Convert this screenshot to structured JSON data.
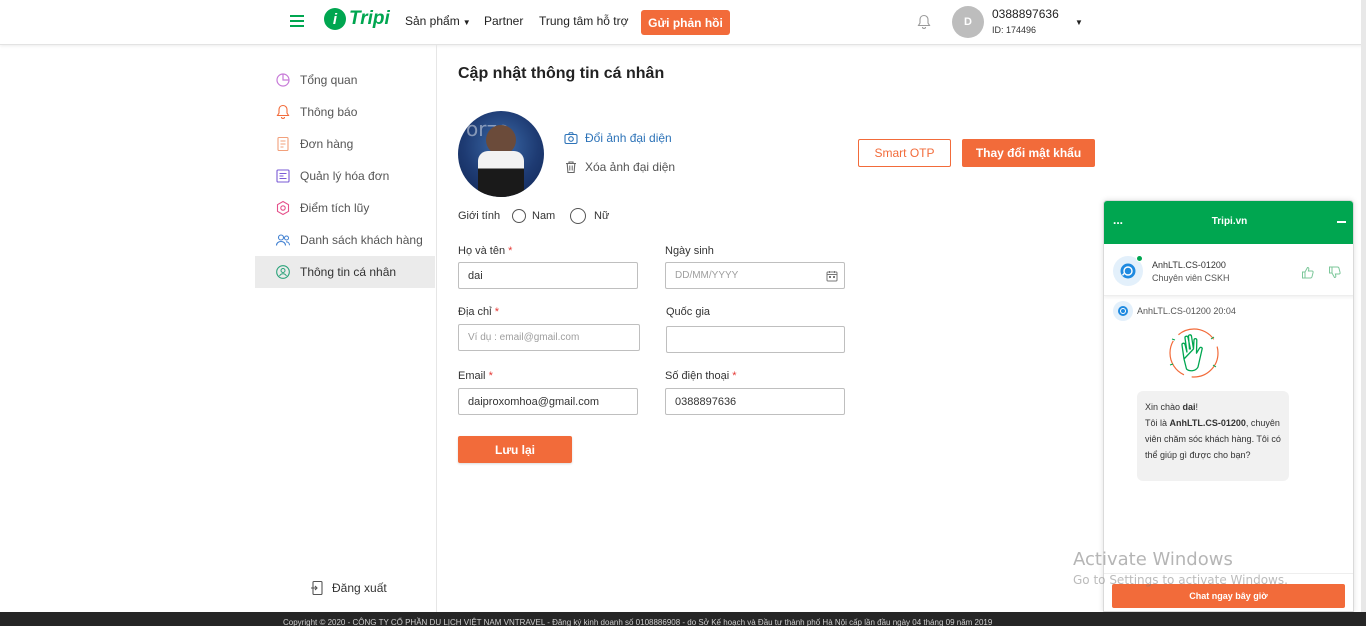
{
  "header": {
    "logo_mark": "i",
    "logo_text": "Tripi",
    "nav_products": "Sản phẩm",
    "nav_partner": "Partner",
    "nav_support": "Trung tâm hỗ trợ",
    "feedback_button": "Gửi phản hồi",
    "avatar_initial": "D",
    "user_phone": "0388897636",
    "user_id": "ID: 174496"
  },
  "sidebar": {
    "items": [
      {
        "label": "Tổng quan",
        "icon": "pie-chart-icon",
        "color": "#c77ad8"
      },
      {
        "label": "Thông báo",
        "icon": "bell-icon",
        "color": "#f26b3a"
      },
      {
        "label": "Đơn hàng",
        "icon": "document-icon",
        "color": "#f2a07b"
      },
      {
        "label": "Quản lý hóa đơn",
        "icon": "invoice-icon",
        "color": "#7a5bd6"
      },
      {
        "label": "Điểm tích lũy",
        "icon": "hexagon-icon",
        "color": "#e5508a"
      },
      {
        "label": "Danh sách khách hàng",
        "icon": "users-icon",
        "color": "#3f7fd1"
      },
      {
        "label": "Thông tin cá nhân",
        "icon": "user-circle-icon",
        "color": "#2aa37a"
      }
    ],
    "logout": "Đăng xuất"
  },
  "main": {
    "title": "Cập nhật thông tin cá nhân",
    "photo_overlay_text": "orzo",
    "change_photo": "Đổi ảnh đại diện",
    "remove_photo": "Xóa ảnh đại diện",
    "smart_otp": "Smart OTP",
    "change_password": "Thay đổi mật khẩu",
    "gender_label": "Giới tính",
    "gender_male": "Nam",
    "gender_female": "Nữ",
    "fullname_label": "Họ và tên",
    "fullname_value": "dai",
    "birthday_label": "Ngày sinh",
    "birthday_placeholder": "DD/MM/YYYY",
    "address_label": "Địa chỉ",
    "address_placeholder": "Ví dụ : email@gmail.com",
    "country_label": "Quốc gia",
    "country_value": "",
    "email_label": "Email",
    "email_value": "daiproxomhoa@gmail.com",
    "phone_label": "Số điện thoại",
    "phone_value": "0388897636",
    "required_mark": "*",
    "save_button": "Lưu lại"
  },
  "chat": {
    "menu_dots": "...",
    "title": "Tripi.vn",
    "agent_name": "AnhLTL.CS-01200",
    "agent_role": "Chuyên viên CSKH",
    "message_meta": "AnhLTL.CS-01200 20:04",
    "greet_prefix": "Xin chào ",
    "greet_name": "dai",
    "greet_suffix": "!",
    "intro_prefix": "Tôi là ",
    "intro_agent": "AnhLTL.CS-01200",
    "intro_suffix": ",",
    "intro_rest": "chuyên viên chăm sóc khách hàng. Tôi có thể giúp gì được cho bạn?",
    "cta": "Chat ngay bây giờ"
  },
  "watermark": {
    "title": "Activate Windows",
    "subtitle": "Go to Settings to activate Windows."
  },
  "footer": {
    "copyright": "Copyright © 2020 - CÔNG TY CỔ PHẦN DU LỊCH VIỆT NAM VNTRAVEL - Đăng ký kinh doanh số 0108886908 - do Sở Kế hoạch và Đầu tư thành phố Hà Nội cấp lần đầu ngày 04 tháng 09 năm 2019"
  },
  "colors": {
    "brand_green": "#00a650",
    "accent_orange": "#f26b3a",
    "link_blue": "#2d73b8"
  }
}
